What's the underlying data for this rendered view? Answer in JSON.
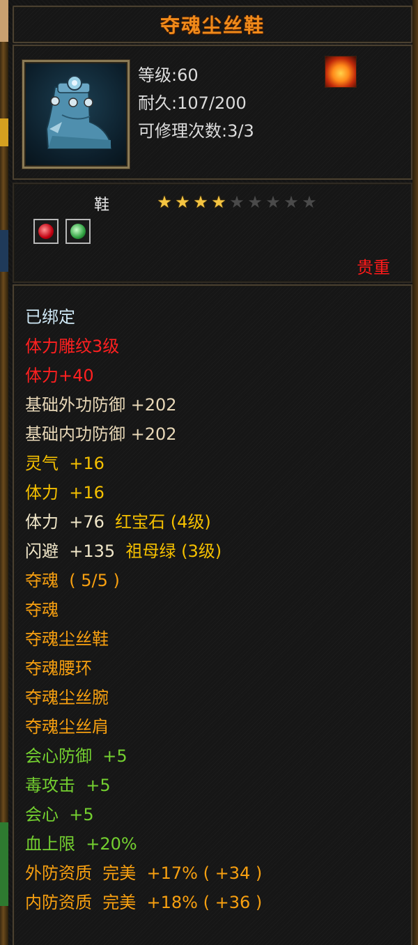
{
  "item": {
    "name": "夺魂尘丝鞋",
    "level_line": "等级:60",
    "durability_line": "耐久:107/200",
    "repair_line": "可修理次数:3/3",
    "type": "鞋",
    "stars_filled": 4,
    "stars_total": 9,
    "rarity": "贵重",
    "icon": "boot-icon",
    "element_icon": "fire-icon"
  },
  "stats": {
    "bound": "已绑定",
    "engrave": "体力雕纹3级",
    "engrave_bonus": "体力+40",
    "base_outer_def": "基础外功防御 +202",
    "base_inner_def": "基础内功防御 +202",
    "spirit": "灵气  +16",
    "stamina": "体力  +16",
    "gem1_stat": "体力  +76",
    "gem1_name": "红宝石 (4级)",
    "gem2_stat": "闪避  +135",
    "gem2_name": "祖母绿 (3级)",
    "set_name": "夺魂  ( 5/5 )",
    "set_items": [
      "夺魂",
      "夺魂尘丝鞋",
      "夺魂腰环",
      "夺魂尘丝腕",
      "夺魂尘丝肩"
    ],
    "crit_def": "会心防御  +5",
    "poison_atk": "毒攻击  +5",
    "crit": "会心  +5",
    "hp_max": "血上限  +20%",
    "outer_quality_label": "外防资质",
    "outer_quality_value": "完美  +17% ( +34 )",
    "inner_quality_label": "内防资质",
    "inner_quality_value": "完美  +18% ( +36 )"
  },
  "colors": {
    "title": "#f08a1a",
    "rarity": "#ff1a1a",
    "engrave": "#ff2020",
    "set": "#f8a010",
    "bonus": "#74d030",
    "gem_name": "#f5c000"
  }
}
